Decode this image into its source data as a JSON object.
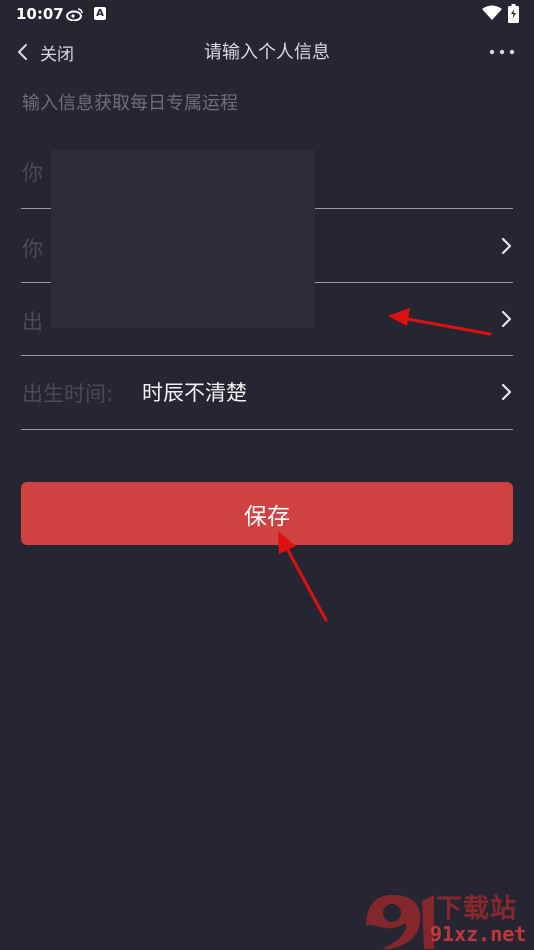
{
  "status_bar": {
    "time": "10:07",
    "a_badge": "A"
  },
  "nav": {
    "back_label": "关闭",
    "title": "请输入个人信息",
    "more_icon": "more-horizontal-icon"
  },
  "subtitle": "输入信息获取每日专属运程",
  "form": {
    "row1": {
      "label_visible": "你"
    },
    "row2": {
      "label_visible": "你"
    },
    "row3": {
      "label_visible": "出"
    },
    "row4": {
      "label": "出生时间:",
      "value": "时辰不清楚"
    }
  },
  "save_button": {
    "label": "保存"
  },
  "watermark": {
    "top_text": "下载站",
    "bottom_text": "91xz.net"
  },
  "colors": {
    "background": "#262633",
    "accent": "#d04141",
    "annotation": "#e01010"
  }
}
